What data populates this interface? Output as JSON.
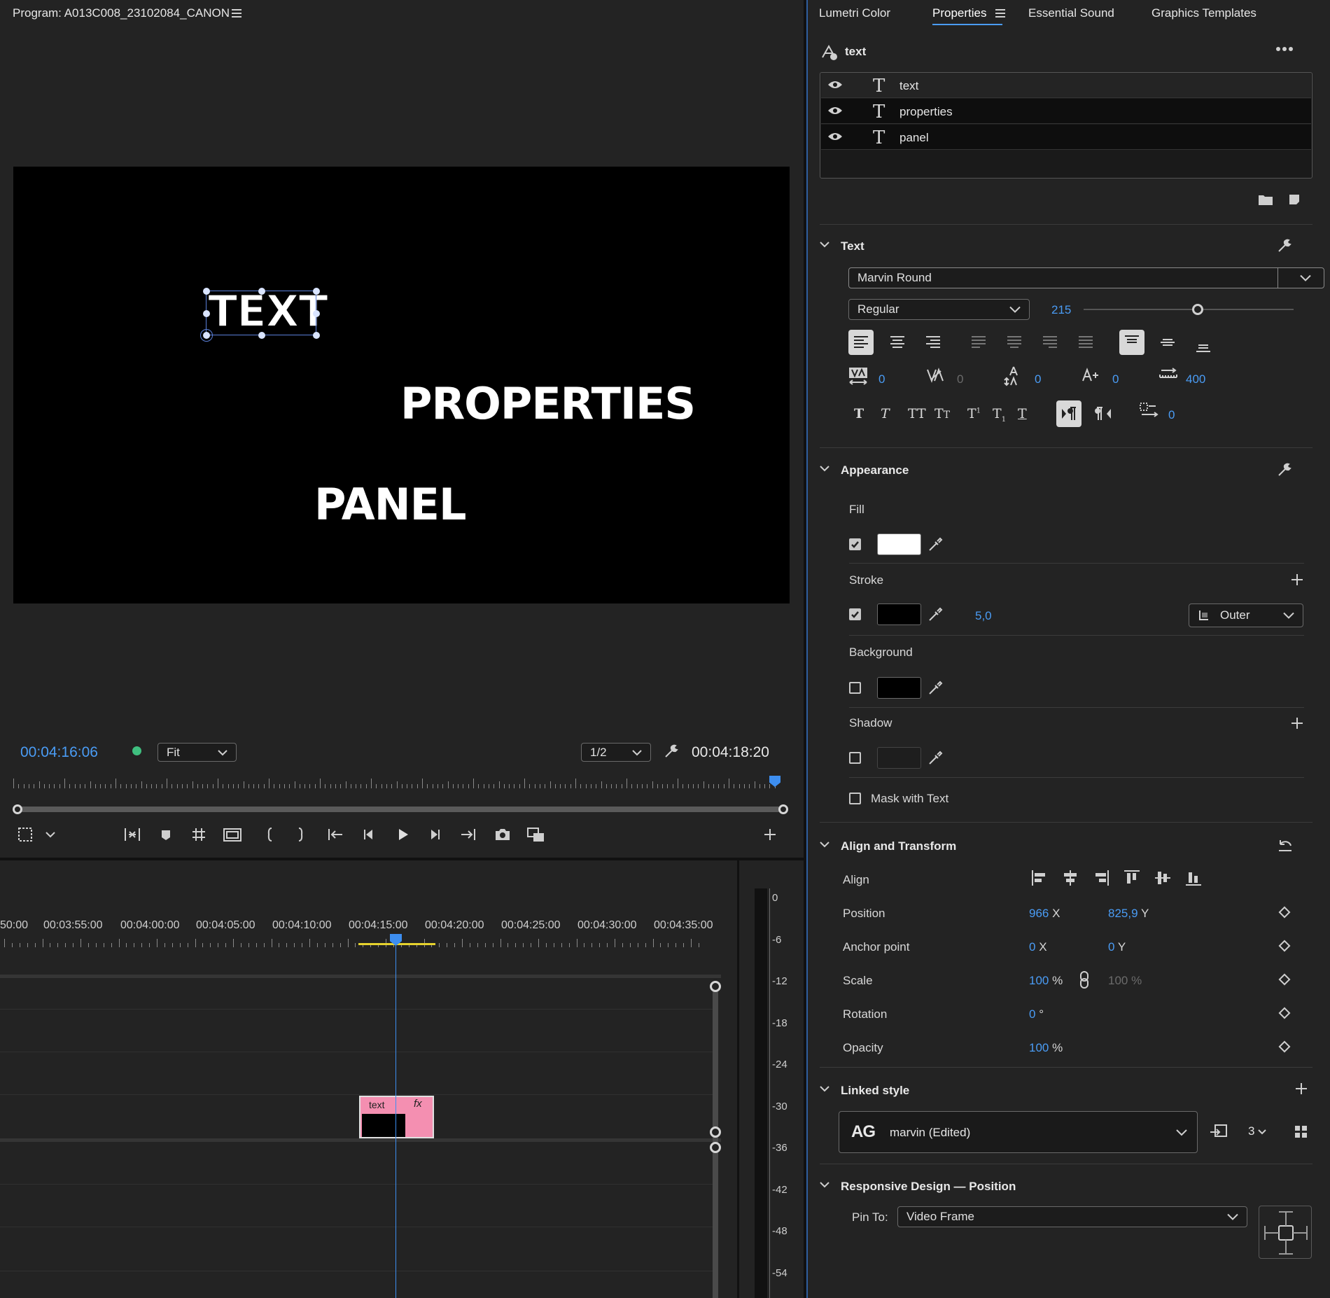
{
  "program_monitor": {
    "title": "Program: A013C008_23102084_CANON",
    "canvas_texts": [
      "TEXT",
      "PROPERTIES",
      "PANEL"
    ],
    "current_time": "00:04:16:06",
    "zoom": "Fit",
    "resolution": "1/2",
    "duration": "00:04:18:20"
  },
  "timeline": {
    "ruler_labels": [
      "50:00",
      "00:03:55:00",
      "00:04:00:00",
      "00:04:05:00",
      "00:04:10:00",
      "00:04:15:00",
      "00:04:20:00",
      "00:04:25:00",
      "00:04:30:00",
      "00:04:35:00"
    ],
    "clip": {
      "label": "text",
      "fx": "fx",
      "color": "#f48fb1"
    },
    "meter_labels": [
      "0",
      "-6",
      "-12",
      "-18",
      "-24",
      "-30",
      "-36",
      "-42",
      "-48",
      "-54"
    ]
  },
  "tabs": [
    {
      "label": "Lumetri Color"
    },
    {
      "label": "Properties",
      "active": true
    },
    {
      "label": "Essential Sound"
    },
    {
      "label": "Graphics Templates"
    }
  ],
  "properties": {
    "header": "text",
    "layers": [
      "text",
      "properties",
      "panel"
    ],
    "text_section": {
      "title": "Text",
      "font": "Marvin Round",
      "style": "Regular",
      "size": "215",
      "kerning": "0",
      "tracking": "0",
      "leading": "0",
      "baseline": "0",
      "tsume": "400",
      "tab_width": "0"
    },
    "appearance": {
      "title": "Appearance",
      "fill_label": "Fill",
      "fill_color": "#ffffff",
      "stroke_label": "Stroke",
      "stroke_color": "#000000",
      "stroke_width": "5,0",
      "stroke_type": "Outer",
      "background_label": "Background",
      "shadow_label": "Shadow",
      "mask_label": "Mask with Text"
    },
    "align_transform": {
      "title": "Align and Transform",
      "align_label": "Align",
      "position_label": "Position",
      "position_x": "966",
      "position_y": "825,9",
      "anchor_label": "Anchor point",
      "anchor_x": "0",
      "anchor_y": "0",
      "scale_label": "Scale",
      "scale": "100",
      "scale_linked": "100 %",
      "rotation_label": "Rotation",
      "rotation": "0",
      "opacity_label": "Opacity",
      "opacity": "100",
      "x": "X",
      "y": "Y",
      "pct": "%",
      "deg": "°"
    },
    "linked_style": {
      "title": "Linked style",
      "ag": "AG",
      "name": "marvin (Edited)",
      "count": "3"
    },
    "responsive": {
      "title": "Responsive Design — Position",
      "pin_label": "Pin To:",
      "pin_value": "Video Frame"
    }
  },
  "colors": {
    "accent": "#4a9cf5",
    "playhead": "#3d8ef0",
    "green_dot": "#3fbf7f"
  }
}
